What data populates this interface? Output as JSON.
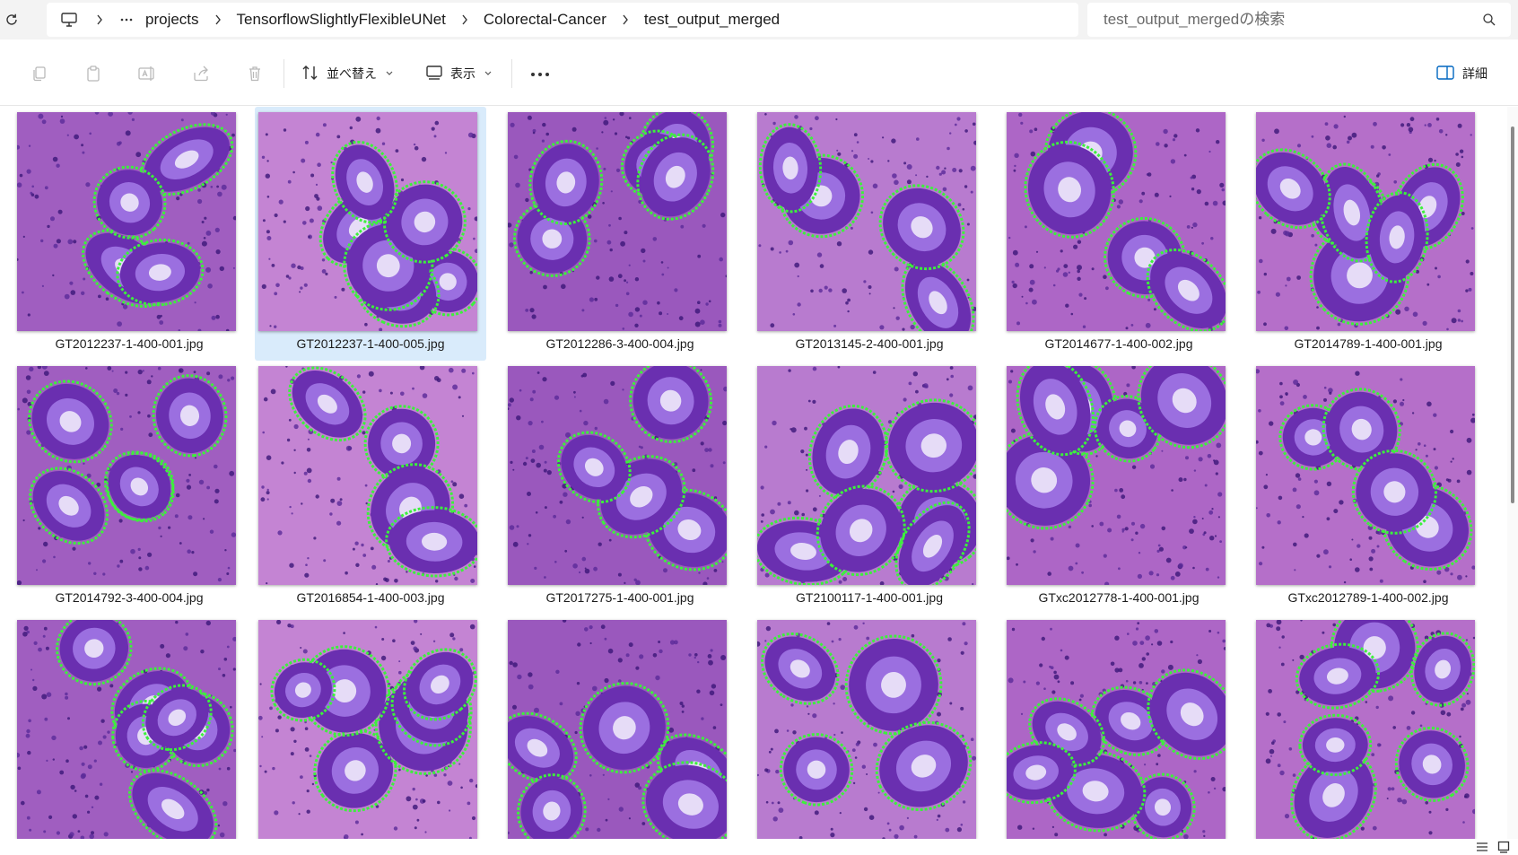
{
  "address_bar": {
    "breadcrumb": [
      "projects",
      "TensorflowSlightlyFlexibleUNet",
      "Colorectal-Cancer",
      "test_output_merged"
    ],
    "search_placeholder": "test_output_mergedの検索"
  },
  "toolbar": {
    "sort_label": "並べ替え",
    "view_label": "表示",
    "details_label": "詳細"
  },
  "icons": {
    "refresh": "refresh-icon",
    "this_pc": "monitor-icon",
    "copy": "copy-icon",
    "paste": "paste-icon",
    "rename": "rename-icon",
    "share": "share-icon",
    "delete": "trash-icon",
    "sort": "sort-icon",
    "view": "view-icon",
    "more": "more-icon",
    "details": "details-pane-icon",
    "search": "search-icon"
  },
  "colors": {
    "selection": "#d9ebfb",
    "stain_purple": "#6a2fb0",
    "stain_pink": "#c77bd8",
    "segmentation_green": "#3cf03c"
  },
  "files": [
    {
      "name": "GT2012237-1-400-001.jpg"
    },
    {
      "name": "GT2012237-1-400-005.jpg",
      "selected": true
    },
    {
      "name": "GT2012286-3-400-004.jpg"
    },
    {
      "name": "GT2013145-2-400-001.jpg"
    },
    {
      "name": "GT2014677-1-400-002.jpg"
    },
    {
      "name": "GT2014789-1-400-001.jpg"
    },
    {
      "name": "GT2014792-3-400-004.jpg"
    },
    {
      "name": "GT2016854-1-400-003.jpg"
    },
    {
      "name": "GT2017275-1-400-001.jpg"
    },
    {
      "name": "GT2100117-1-400-001.jpg"
    },
    {
      "name": "GTxc2012778-1-400-001.jpg"
    },
    {
      "name": "GTxc2012789-1-400-002.jpg"
    },
    {
      "name": ""
    },
    {
      "name": ""
    },
    {
      "name": ""
    },
    {
      "name": ""
    },
    {
      "name": ""
    },
    {
      "name": ""
    }
  ]
}
